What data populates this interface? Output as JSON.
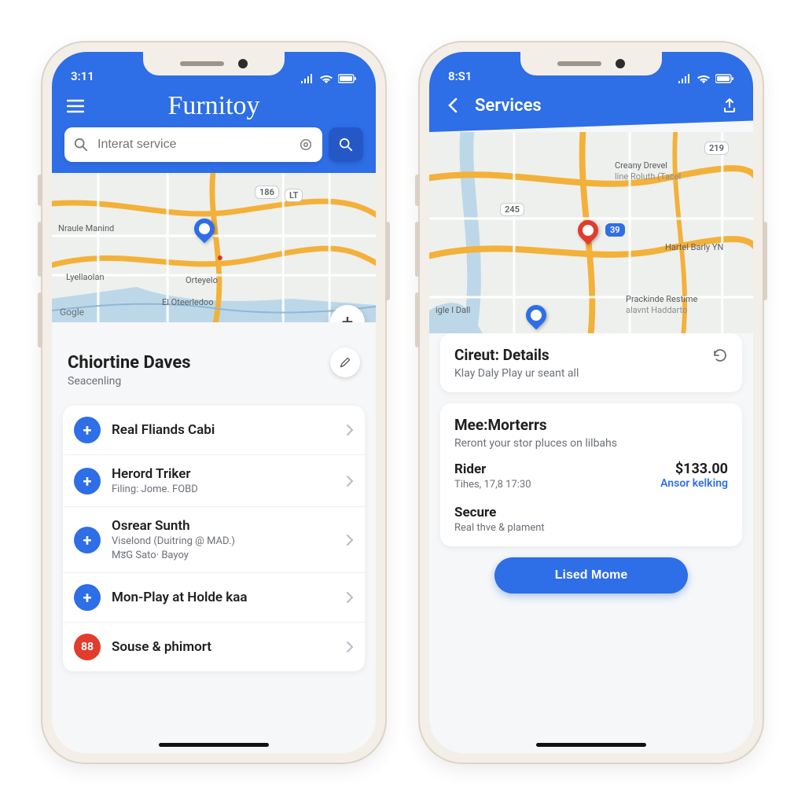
{
  "colors": {
    "accent": "#2E6EE6",
    "danger": "#E23C2C"
  },
  "status": {
    "time_left": "3:11",
    "time_right": "8:S1"
  },
  "left": {
    "brand": "Furnitoy",
    "search": {
      "placeholder": "Interat service"
    },
    "map": {
      "attrib": "Gogle",
      "labels": [
        "Nraule Manind",
        "Lyellaolan",
        "Orteyelo",
        "El Oteerledoo"
      ],
      "badges": [
        "186",
        "LT"
      ]
    },
    "section": {
      "title": "Chiortine Daves",
      "subtitle": "Seacenling"
    },
    "items": [
      {
        "icon": "plus",
        "title": "Real Fliands Cabi",
        "subtitle": ""
      },
      {
        "icon": "plus",
        "title": "Herord Triker",
        "subtitle": "Filing: Jome. FOBD"
      },
      {
        "icon": "plus",
        "title": "Osrear Sunth",
        "subtitle": "Viselond (Duitring @ MAD.)\nMडG Sato· Bayoy"
      },
      {
        "icon": "plus",
        "title": "Mon-Play at Holde kaa",
        "subtitle": ""
      },
      {
        "icon": "88",
        "title": "Souse & phimort",
        "subtitle": "",
        "variant": "red"
      }
    ]
  },
  "right": {
    "header_title": "Services",
    "map": {
      "labels": [
        "Creany Drevel",
        "line Roluth (Tacel",
        "Hartel Barly YN",
        "Prackinde Restime",
        "alavnt Haddarto",
        "igle I Dall"
      ],
      "badges": [
        "219",
        "245",
        "39"
      ]
    },
    "details": {
      "title": "Cireut: Details",
      "subtitle": "Klay Daly Play ur seant all"
    },
    "card2": {
      "title": "Mee:Morterrs",
      "subtitle": "Reront your stor pluces on lilbahs",
      "rider_label": "Rider",
      "rider_price": "$133.00",
      "rider_meta": "Tihes, 17,8 17:30",
      "rider_link": "Ansor kelking",
      "secure_label": "Secure",
      "secure_meta": "Real thve & plament"
    },
    "cta": "Lised Mome"
  }
}
